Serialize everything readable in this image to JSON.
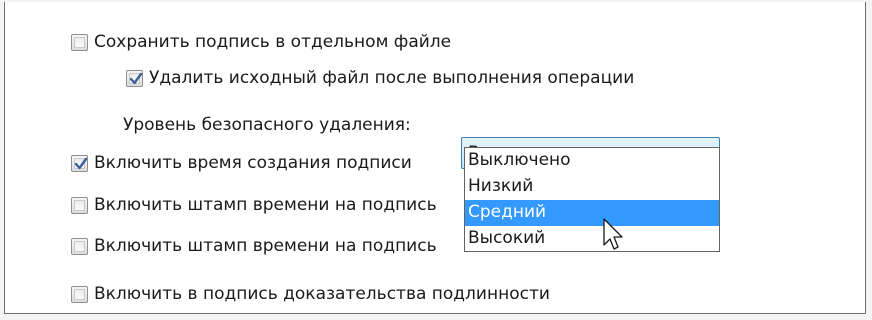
{
  "options": {
    "save_signature": {
      "label": "Сохранить подпись в отдельном файле",
      "checked": false
    },
    "delete_source": {
      "label": "Удалить исходный файл после выполнения операции",
      "checked": true
    },
    "secure_delete_level_label": "Уровень безопасного удаления:",
    "include_time": {
      "label": "Включить время создания подписи",
      "checked": true
    },
    "timestamp_1": {
      "label": "Включить штамп времени на подпись",
      "checked": false
    },
    "timestamp_2": {
      "label": "Включить штамп времени на подпись",
      "checked": false
    },
    "include_proof": {
      "label": "Включить в подпись доказательства подлинности",
      "checked": false
    }
  },
  "secure_delete_select": {
    "value": "Выключено",
    "items": [
      "Выключено",
      "Низкий",
      "Средний",
      "Высокий"
    ],
    "highlighted": "Средний"
  },
  "colors": {
    "highlight": "#3399ff",
    "select_border": "#3c7fb1"
  }
}
